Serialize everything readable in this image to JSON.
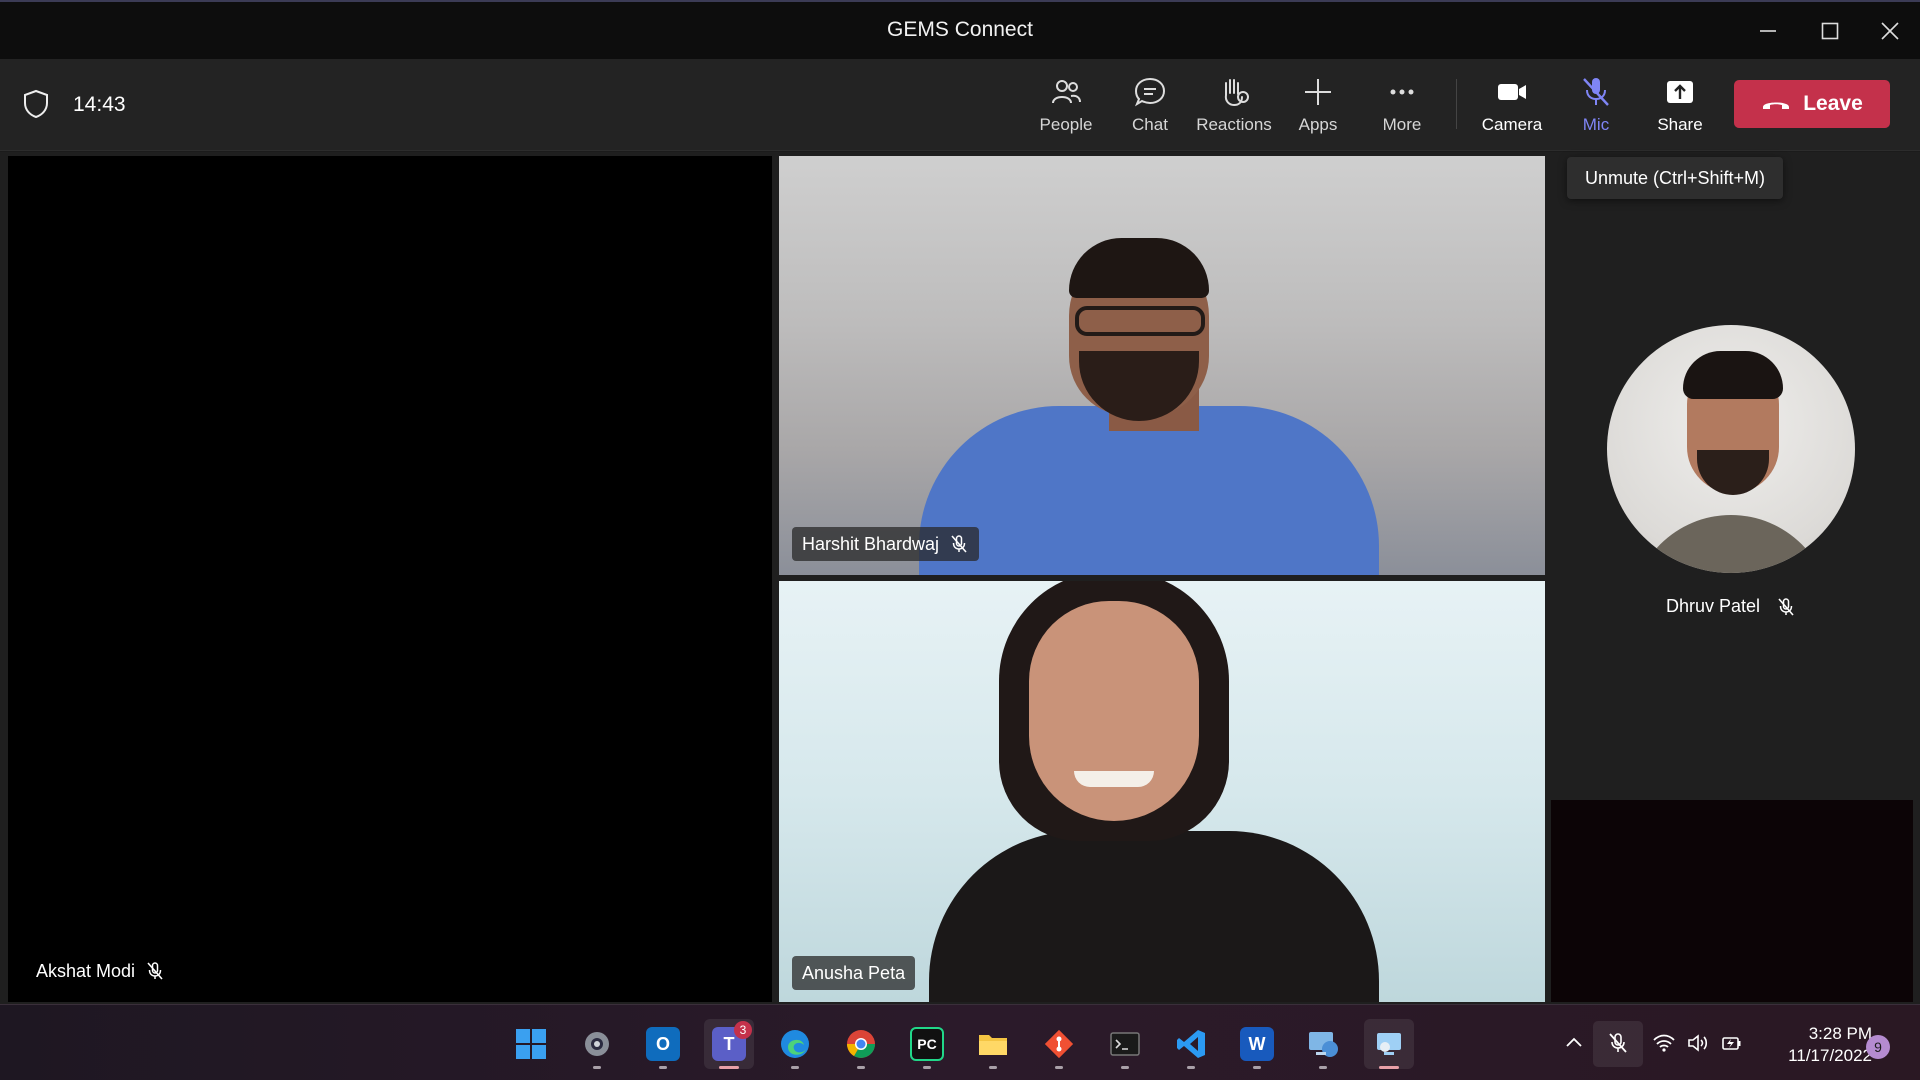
{
  "window": {
    "title": "GEMS Connect"
  },
  "toolbar": {
    "timer": "14:43",
    "buttons": {
      "people": "People",
      "chat": "Chat",
      "reactions": "Reactions",
      "apps": "Apps",
      "more": "More",
      "camera": "Camera",
      "mic": "Mic",
      "share": "Share"
    },
    "leave_label": "Leave"
  },
  "tooltip": {
    "mic": "Unmute (Ctrl+Shift+M)"
  },
  "participants": {
    "akshat": {
      "name": "Akshat Modi",
      "muted": true
    },
    "harshit": {
      "name": "Harshit Bhardwaj",
      "muted": true
    },
    "anusha": {
      "name": "Anusha Peta",
      "muted": false
    },
    "dhruv": {
      "name": "Dhruv Patel",
      "muted": true
    }
  },
  "colors": {
    "leave": "#c4314b",
    "mic_active": "#7f85f5",
    "titlebar": "#0d0d0d",
    "toolbar": "#232323"
  },
  "taskbar": {
    "apps": [
      "start-icon",
      "settings-icon",
      "outlook-icon",
      "teams-icon",
      "edge-icon",
      "chrome-icon",
      "pycharm-icon",
      "file-explorer-icon",
      "git-icon",
      "terminal-icon",
      "vscode-icon",
      "word-icon",
      "network-icon",
      "remote-desktop-icon"
    ],
    "teams_badge": "3",
    "clock": {
      "time": "3:28 PM",
      "date": "11/17/2022"
    },
    "notifications": "9"
  }
}
